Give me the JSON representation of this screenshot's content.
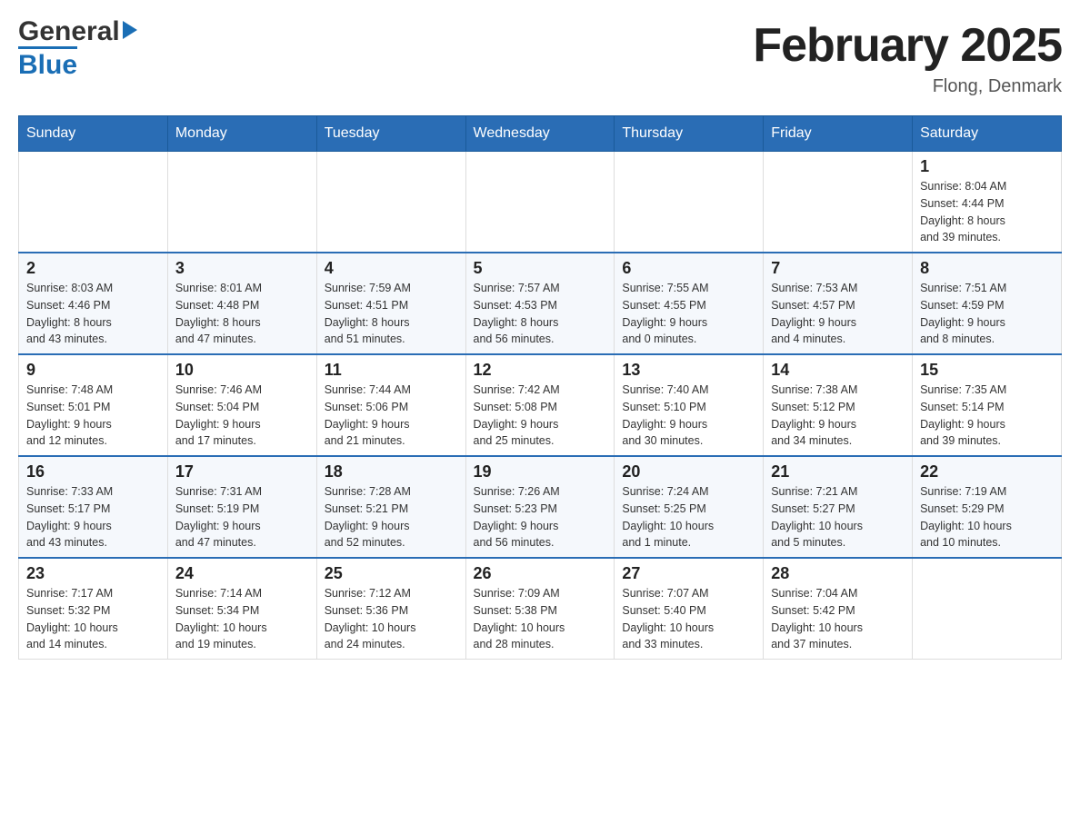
{
  "header": {
    "logo": {
      "part1": "General",
      "part2": "Blue"
    },
    "title": "February 2025",
    "location": "Flong, Denmark"
  },
  "weekdays": [
    "Sunday",
    "Monday",
    "Tuesday",
    "Wednesday",
    "Thursday",
    "Friday",
    "Saturday"
  ],
  "weeks": [
    [
      {
        "day": "",
        "info": ""
      },
      {
        "day": "",
        "info": ""
      },
      {
        "day": "",
        "info": ""
      },
      {
        "day": "",
        "info": ""
      },
      {
        "day": "",
        "info": ""
      },
      {
        "day": "",
        "info": ""
      },
      {
        "day": "1",
        "info": "Sunrise: 8:04 AM\nSunset: 4:44 PM\nDaylight: 8 hours\nand 39 minutes."
      }
    ],
    [
      {
        "day": "2",
        "info": "Sunrise: 8:03 AM\nSunset: 4:46 PM\nDaylight: 8 hours\nand 43 minutes."
      },
      {
        "day": "3",
        "info": "Sunrise: 8:01 AM\nSunset: 4:48 PM\nDaylight: 8 hours\nand 47 minutes."
      },
      {
        "day": "4",
        "info": "Sunrise: 7:59 AM\nSunset: 4:51 PM\nDaylight: 8 hours\nand 51 minutes."
      },
      {
        "day": "5",
        "info": "Sunrise: 7:57 AM\nSunset: 4:53 PM\nDaylight: 8 hours\nand 56 minutes."
      },
      {
        "day": "6",
        "info": "Sunrise: 7:55 AM\nSunset: 4:55 PM\nDaylight: 9 hours\nand 0 minutes."
      },
      {
        "day": "7",
        "info": "Sunrise: 7:53 AM\nSunset: 4:57 PM\nDaylight: 9 hours\nand 4 minutes."
      },
      {
        "day": "8",
        "info": "Sunrise: 7:51 AM\nSunset: 4:59 PM\nDaylight: 9 hours\nand 8 minutes."
      }
    ],
    [
      {
        "day": "9",
        "info": "Sunrise: 7:48 AM\nSunset: 5:01 PM\nDaylight: 9 hours\nand 12 minutes."
      },
      {
        "day": "10",
        "info": "Sunrise: 7:46 AM\nSunset: 5:04 PM\nDaylight: 9 hours\nand 17 minutes."
      },
      {
        "day": "11",
        "info": "Sunrise: 7:44 AM\nSunset: 5:06 PM\nDaylight: 9 hours\nand 21 minutes."
      },
      {
        "day": "12",
        "info": "Sunrise: 7:42 AM\nSunset: 5:08 PM\nDaylight: 9 hours\nand 25 minutes."
      },
      {
        "day": "13",
        "info": "Sunrise: 7:40 AM\nSunset: 5:10 PM\nDaylight: 9 hours\nand 30 minutes."
      },
      {
        "day": "14",
        "info": "Sunrise: 7:38 AM\nSunset: 5:12 PM\nDaylight: 9 hours\nand 34 minutes."
      },
      {
        "day": "15",
        "info": "Sunrise: 7:35 AM\nSunset: 5:14 PM\nDaylight: 9 hours\nand 39 minutes."
      }
    ],
    [
      {
        "day": "16",
        "info": "Sunrise: 7:33 AM\nSunset: 5:17 PM\nDaylight: 9 hours\nand 43 minutes."
      },
      {
        "day": "17",
        "info": "Sunrise: 7:31 AM\nSunset: 5:19 PM\nDaylight: 9 hours\nand 47 minutes."
      },
      {
        "day": "18",
        "info": "Sunrise: 7:28 AM\nSunset: 5:21 PM\nDaylight: 9 hours\nand 52 minutes."
      },
      {
        "day": "19",
        "info": "Sunrise: 7:26 AM\nSunset: 5:23 PM\nDaylight: 9 hours\nand 56 minutes."
      },
      {
        "day": "20",
        "info": "Sunrise: 7:24 AM\nSunset: 5:25 PM\nDaylight: 10 hours\nand 1 minute."
      },
      {
        "day": "21",
        "info": "Sunrise: 7:21 AM\nSunset: 5:27 PM\nDaylight: 10 hours\nand 5 minutes."
      },
      {
        "day": "22",
        "info": "Sunrise: 7:19 AM\nSunset: 5:29 PM\nDaylight: 10 hours\nand 10 minutes."
      }
    ],
    [
      {
        "day": "23",
        "info": "Sunrise: 7:17 AM\nSunset: 5:32 PM\nDaylight: 10 hours\nand 14 minutes."
      },
      {
        "day": "24",
        "info": "Sunrise: 7:14 AM\nSunset: 5:34 PM\nDaylight: 10 hours\nand 19 minutes."
      },
      {
        "day": "25",
        "info": "Sunrise: 7:12 AM\nSunset: 5:36 PM\nDaylight: 10 hours\nand 24 minutes."
      },
      {
        "day": "26",
        "info": "Sunrise: 7:09 AM\nSunset: 5:38 PM\nDaylight: 10 hours\nand 28 minutes."
      },
      {
        "day": "27",
        "info": "Sunrise: 7:07 AM\nSunset: 5:40 PM\nDaylight: 10 hours\nand 33 minutes."
      },
      {
        "day": "28",
        "info": "Sunrise: 7:04 AM\nSunset: 5:42 PM\nDaylight: 10 hours\nand 37 minutes."
      },
      {
        "day": "",
        "info": ""
      }
    ]
  ]
}
